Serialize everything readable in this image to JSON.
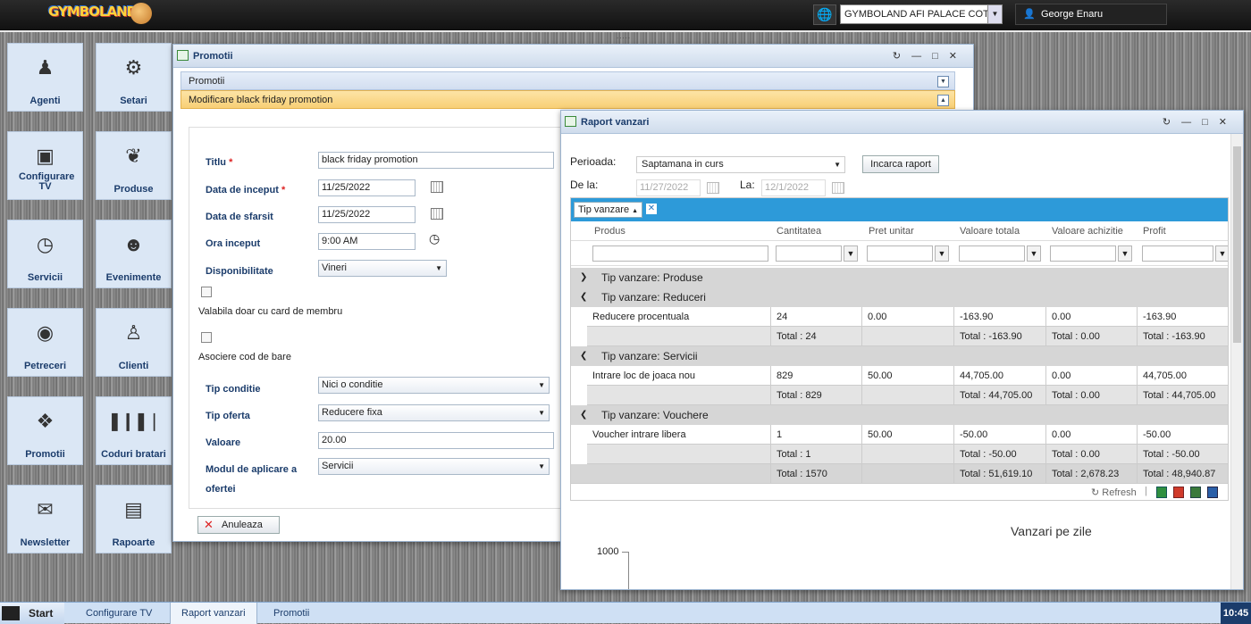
{
  "header": {
    "logo_text": "GYMBOLAND",
    "location": "GYMBOLAND AFI PALACE COTRC",
    "user": "George Enaru"
  },
  "tiles": [
    {
      "label": "Agenti",
      "icon": "user-icon"
    },
    {
      "label": "Setari",
      "icon": "gear-icon"
    },
    {
      "label": "Configurare TV",
      "icon": "monitor-icon"
    },
    {
      "label": "Produse",
      "icon": "candy-icon"
    },
    {
      "label": "Servicii",
      "icon": "clock-icon"
    },
    {
      "label": "Evenimente",
      "icon": "mouse-face-icon"
    },
    {
      "label": "Petreceri",
      "icon": "balloons-icon"
    },
    {
      "label": "Clienti",
      "icon": "people-icon"
    },
    {
      "label": "Promotii",
      "icon": "tag-icon"
    },
    {
      "label": "Coduri bratari",
      "icon": "barcode-icon"
    },
    {
      "label": "Newsletter",
      "icon": "mail-icon"
    },
    {
      "label": "Rapoarte",
      "icon": "chart-icon"
    }
  ],
  "promo_window": {
    "title": "Promotii",
    "bar1": "Promotii",
    "bar2": "Modificare black friday promotion",
    "fields": {
      "titlu_label": "Titlu",
      "titlu_value": "black friday promotion",
      "data_inceput_label": "Data de inceput",
      "data_inceput_value": "11/25/2022",
      "data_sfarsit_label": "Data de sfarsit",
      "data_sfarsit_value": "11/25/2022",
      "ora_label": "Ora inceput",
      "ora_value": "9:00 AM",
      "disp_label": "Disponibilitate",
      "disp_value": "Vineri",
      "card_label": "Valabila doar cu card de membru",
      "barcode_label": "Asociere cod de bare",
      "tip_conditie_label": "Tip conditie",
      "tip_conditie_value": "Nici o conditie",
      "tip_oferta_label": "Tip oferta",
      "tip_oferta_value": "Reducere fixa",
      "valoare_label": "Valoare",
      "valoare_value": "20.00",
      "modul_label_1": "Modul de aplicare a",
      "modul_label_2": "ofertei",
      "modul_value": "Servicii"
    },
    "cancel_label": "Anuleaza"
  },
  "report_window": {
    "title": "Raport vanzari",
    "perioada_label": "Perioada:",
    "perioada_value": "Saptamana in curs",
    "load_label": "Incarca raport",
    "from_label": "De la:",
    "from_value": "11/27/2022",
    "to_label": "La:",
    "to_value": "12/1/2022",
    "group_chip": "Tip vanzare",
    "columns": [
      "Produs",
      "Cantitatea",
      "Pret unitar",
      "Valoare totala",
      "Valoare achizitie",
      "Profit"
    ],
    "groups": [
      {
        "label": "Tip vanzare: Produse",
        "expanded": false,
        "rows": []
      },
      {
        "label": "Tip vanzare: Reduceri",
        "expanded": true,
        "rows": [
          [
            "Reducere procentuala",
            "24",
            "0.00",
            "-163.90",
            "0.00",
            "-163.90"
          ]
        ],
        "totals": [
          "",
          "Total : 24",
          "",
          "Total : -163.90",
          "Total : 0.00",
          "Total : -163.90"
        ]
      },
      {
        "label": "Tip vanzare: Servicii",
        "expanded": true,
        "rows": [
          [
            "Intrare loc de joaca nou",
            "829",
            "50.00",
            "44,705.00",
            "0.00",
            "44,705.00"
          ]
        ],
        "totals": [
          "",
          "Total : 829",
          "",
          "Total : 44,705.00",
          "Total : 0.00",
          "Total : 44,705.00"
        ]
      },
      {
        "label": "Tip vanzare: Vouchere",
        "expanded": true,
        "rows": [
          [
            "Voucher intrare libera",
            "1",
            "50.00",
            "-50.00",
            "0.00",
            "-50.00"
          ]
        ],
        "totals": [
          "",
          "Total : 1",
          "",
          "Total : -50.00",
          "Total : 0.00",
          "Total : -50.00"
        ]
      }
    ],
    "grand_totals": [
      "",
      "Total : 1570",
      "",
      "Total : 51,619.10",
      "Total : 2,678.23",
      "Total : 48,940.87"
    ],
    "refresh_label": "Refresh",
    "chart_title": "Vanzari pe zile",
    "chart_y_tick": "1000"
  },
  "taskbar": {
    "start": "Start",
    "items": [
      "Configurare TV",
      "Raport vanzari",
      "Promotii"
    ],
    "clock": "10:45"
  }
}
